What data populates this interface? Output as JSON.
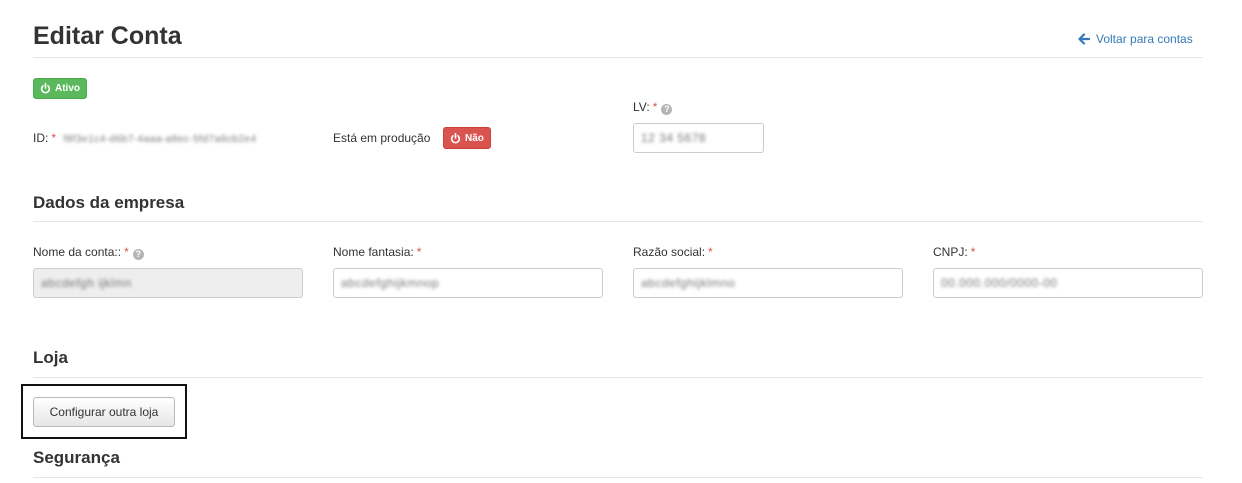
{
  "header": {
    "title": "Editar Conta",
    "back_link": "Voltar para contas"
  },
  "status": {
    "active_label": "Ativo",
    "id_label": "ID:",
    "id_value": "f8f3e1c4-d6b7-4aaa-a8ec-5fd7a6cb2e4",
    "production_label": "Está em produção",
    "production_value": "Não",
    "lv_label": "LV:",
    "lv_value": "12 34 5678"
  },
  "company": {
    "title": "Dados da empresa",
    "fields": [
      {
        "label": "Nome da conta::",
        "value": "abcdefgh ijklmn",
        "disabled": true,
        "help": true
      },
      {
        "label": "Nome fantasia:",
        "value": "abcdefghijkmnop",
        "disabled": false
      },
      {
        "label": "Razão social:",
        "value": "abcdefghijklmno",
        "disabled": false
      },
      {
        "label": "CNPJ:",
        "value": "00.000.000/0000-00",
        "disabled": false
      }
    ]
  },
  "store": {
    "title": "Loja",
    "configure_button": "Configurar outra loja"
  },
  "security": {
    "title": "Segurança"
  },
  "colors": {
    "link": "#337ab7",
    "success": "#5cb85c",
    "danger": "#d9534f",
    "required": "#d9534f"
  },
  "icons": {
    "back": "arrow-left-icon",
    "power": "power-icon",
    "help": "question-circle-icon"
  }
}
